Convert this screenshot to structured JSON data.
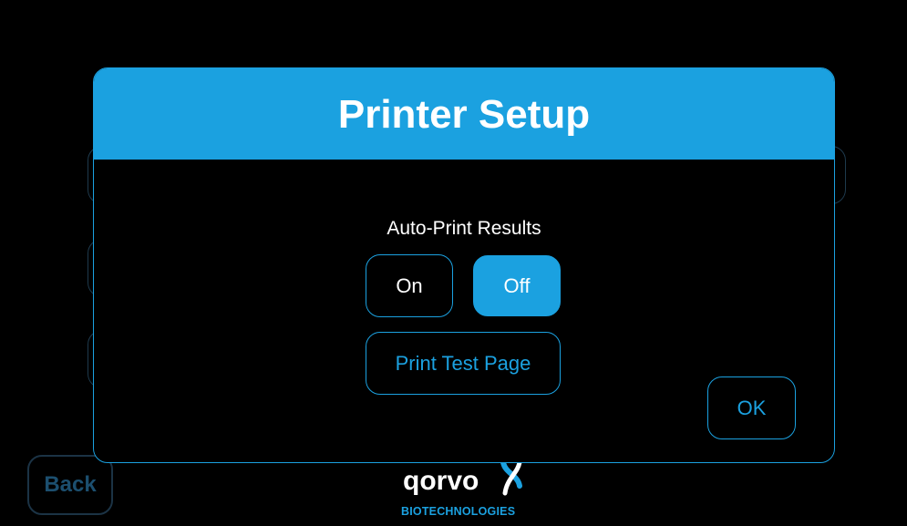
{
  "background": {
    "back_label": "Back"
  },
  "logo": {
    "wordmark": "qorvo",
    "subtitle": "BIOTECHNOLOGIES"
  },
  "modal": {
    "title": "Printer Setup",
    "auto_print": {
      "label": "Auto-Print Results",
      "options": [
        "On",
        "Off"
      ],
      "selected": "Off"
    },
    "test_page_label": "Print Test Page",
    "ok_label": "OK"
  },
  "colors": {
    "accent": "#1ba1e0",
    "background": "#000000",
    "text": "#ffffff"
  }
}
